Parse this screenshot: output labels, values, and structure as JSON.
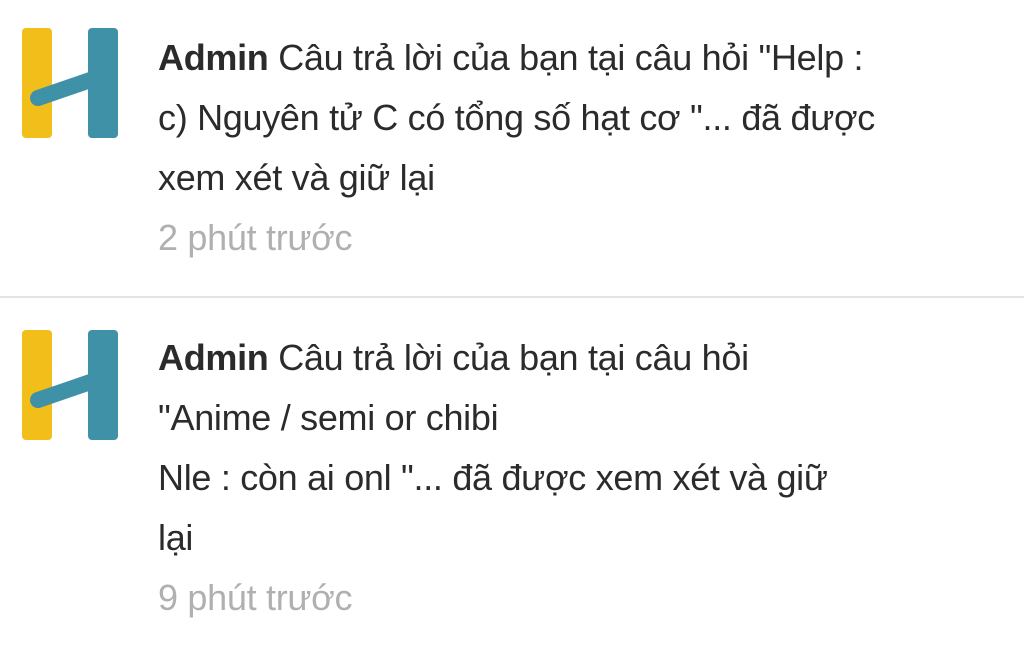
{
  "brand": {
    "logo_letter": "H",
    "colors": {
      "yellow": "#F2BE1A",
      "teal": "#3F91A8"
    }
  },
  "notifications": [
    {
      "author": "Admin",
      "message_lines": [
        "Câu trả lời của bạn tại câu hỏi \"Help :",
        "c) Nguyên tử C có tổng số hạt cơ  \"... đã được",
        "xem xét và giữ lại"
      ],
      "time": "2 phút trước"
    },
    {
      "author": "Admin",
      "message_lines": [
        "Câu trả lời của bạn tại câu hỏi",
        "\"Anime / semi or chibi",
        "Nle : còn ai onl  \"... đã được xem xét và giữ",
        "lại"
      ],
      "time": "9 phút trước"
    }
  ],
  "colors": {
    "text": "#2b2b2b",
    "muted": "#b0b0b0",
    "divider": "#e4e4e4"
  }
}
